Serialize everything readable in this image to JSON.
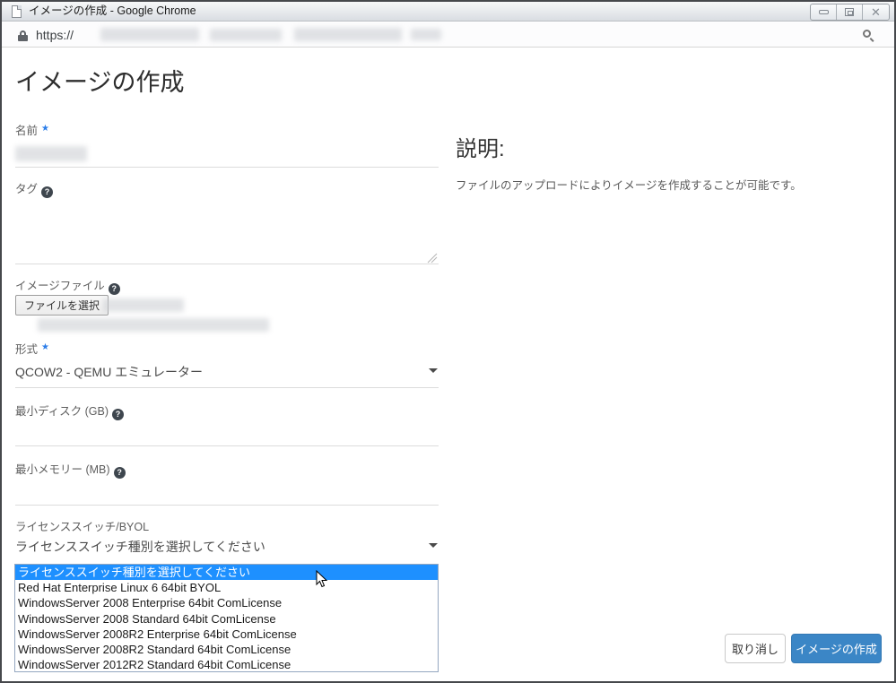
{
  "window": {
    "title": "イメージの作成 - Google Chrome"
  },
  "urlbar": {
    "protocol": "https://"
  },
  "ui": {
    "required_star": "★",
    "help_glyph": "?",
    "close_glyph": "✕"
  },
  "page": {
    "title": "イメージの作成"
  },
  "form": {
    "name": {
      "label": "名前"
    },
    "tags": {
      "label": "タグ"
    },
    "image_file": {
      "label": "イメージファイル",
      "choose_file_button": "ファイルを選択"
    },
    "format": {
      "label": "形式",
      "value": "QCOW2 - QEMU エミュレーター"
    },
    "min_disk": {
      "label": "最小ディスク (GB)"
    },
    "min_ram": {
      "label": "最小メモリー (MB)"
    },
    "license": {
      "label": "ライセンススイッチ/BYOL",
      "value": "ライセンススイッチ種別を選択してください"
    },
    "license_dropdown": {
      "selected_index": 0,
      "options": [
        "ライセンススイッチ種別を選択してください",
        "Red Hat Enterprise Linux 6 64bit BYOL",
        "WindowsServer 2008 Enterprise 64bit ComLicense",
        "WindowsServer 2008 Standard 64bit ComLicense",
        "WindowsServer 2008R2 Enterprise 64bit ComLicense",
        "WindowsServer 2008R2 Standard 64bit ComLicense",
        "WindowsServer 2012R2 Standard 64bit ComLicense"
      ]
    }
  },
  "description_panel": {
    "heading": "説明:",
    "text": "ファイルのアップロードによりイメージを作成することが可能です。"
  },
  "footer": {
    "cancel_label": "取り消し",
    "submit_label": "イメージの作成"
  },
  "colors": {
    "primary_button": "#3b86c6",
    "dropdown_highlight": "#1e90ff",
    "required_star": "#2b7de9"
  }
}
